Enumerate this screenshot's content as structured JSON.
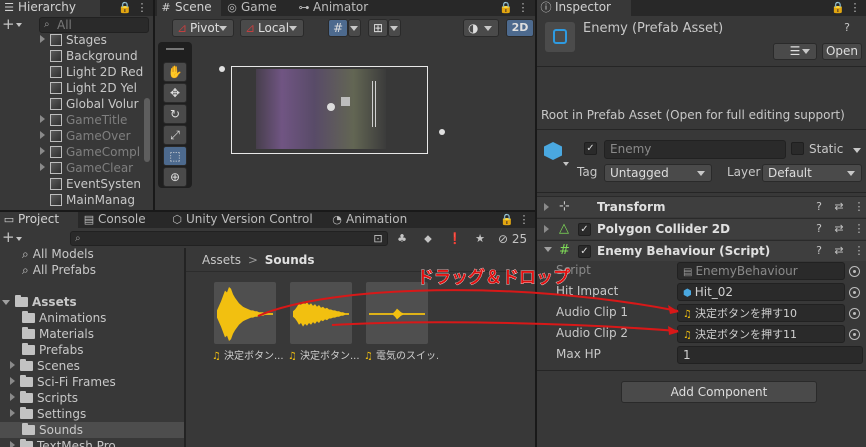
{
  "hierarchy": {
    "tab_label": "Hierarchy",
    "search_placeholder": "All",
    "items": [
      "Stages",
      "Background",
      "Light 2D Red",
      "Light 2D Yel",
      "Global Volur",
      "GameTitle",
      "GameOver",
      "GameCompl",
      "GameClear",
      "EventSysten",
      "MainManag"
    ]
  },
  "scene": {
    "tabs": [
      "Scene",
      "Game",
      "Animator"
    ],
    "pivot_label": "Pivot",
    "local_label": "Local",
    "mode_2d": "2D"
  },
  "project": {
    "tabs": [
      "Project",
      "Console",
      "Unity Version Control",
      "Animation"
    ],
    "tree": [
      "All Models",
      "All Prefabs",
      "Assets",
      "Animations",
      "Materials",
      "Prefabs",
      "Scenes",
      "Sci-Fi Frames",
      "Scripts",
      "Settings",
      "Sounds",
      "TextMesh Pro"
    ],
    "breadcrumb_root": "Assets",
    "breadcrumb_sep": ">",
    "breadcrumb_current": "Sounds",
    "hidden_count": "25",
    "assets": [
      {
        "label": "決定ボタン...",
        "color": "#f2c010"
      },
      {
        "label": "決定ボタン...",
        "color": "#f2c010"
      },
      {
        "label": "電気のスイッ...",
        "color": "#f2c010"
      }
    ]
  },
  "annotation": {
    "text": "ドラッグ＆ドロップ",
    "color": "#e01010"
  },
  "inspector": {
    "tab_label": "Inspector",
    "title": "Enemy (Prefab Asset)",
    "open_button": "Open",
    "root_notice": "Root in Prefab Asset (Open for full editing support)",
    "name_value": "Enemy",
    "static_label": "Static",
    "tag_label": "Tag",
    "tag_value": "Untagged",
    "layer_label": "Layer",
    "layer_value": "Default",
    "components": [
      "Transform",
      "Polygon Collider 2D",
      "Enemy Behaviour (Script)"
    ],
    "fields": [
      {
        "label": "Script",
        "value": "EnemyBehaviour"
      },
      {
        "label": "Hit Impact",
        "value": "Hit_02"
      },
      {
        "label": "Audio Clip 1",
        "value": "決定ボタンを押す10"
      },
      {
        "label": "Audio Clip 2",
        "value": "決定ボタンを押す11"
      },
      {
        "label": "Max HP",
        "value": "1"
      }
    ],
    "add_component": "Add Component"
  }
}
